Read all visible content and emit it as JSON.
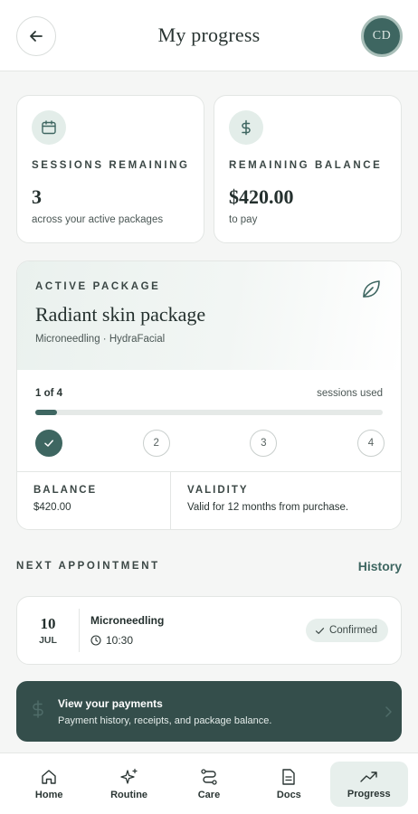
{
  "header": {
    "title": "My progress",
    "avatar_initials": "CD"
  },
  "stats": {
    "sessions": {
      "label": "SESSIONS REMAINING",
      "value": "3",
      "sub": "across your active packages",
      "icon": "calendar-icon"
    },
    "balance": {
      "label": "REMAINING BALANCE",
      "value": "$420.00",
      "sub": "to pay",
      "icon": "dollar-icon"
    }
  },
  "package": {
    "label": "ACTIVE PACKAGE",
    "name": "Radiant skin package",
    "services": "Microneedling · HydraFacial",
    "progress_text": "1 of 4",
    "progress_caption": "sessions used",
    "sessions_used": 1,
    "sessions_total": 4,
    "steps": [
      "1",
      "2",
      "3",
      "4"
    ],
    "balance_label": "BALANCE",
    "balance_value": "$420.00",
    "validity_label": "VALIDITY",
    "validity_value": "Valid for 12 months from purchase."
  },
  "appointment": {
    "section_title": "NEXT APPOINTMENT",
    "history_label": "History",
    "day": "10",
    "month": "JUL",
    "service": "Microneedling",
    "time": "10:30",
    "status": "Confirmed"
  },
  "payments": {
    "title": "View your payments",
    "subtitle": "Payment history, receipts, and package balance."
  },
  "nav": {
    "items": [
      {
        "label": "Home",
        "icon": "home-icon"
      },
      {
        "label": "Routine",
        "icon": "sparkle-icon"
      },
      {
        "label": "Care",
        "icon": "care-icon"
      },
      {
        "label": "Docs",
        "icon": "document-icon"
      },
      {
        "label": "Progress",
        "icon": "trending-up-icon"
      }
    ],
    "active_index": 4
  },
  "colors": {
    "accent": "#3e6661",
    "banner": "#344e4b",
    "badge_bg": "#e7efec"
  }
}
